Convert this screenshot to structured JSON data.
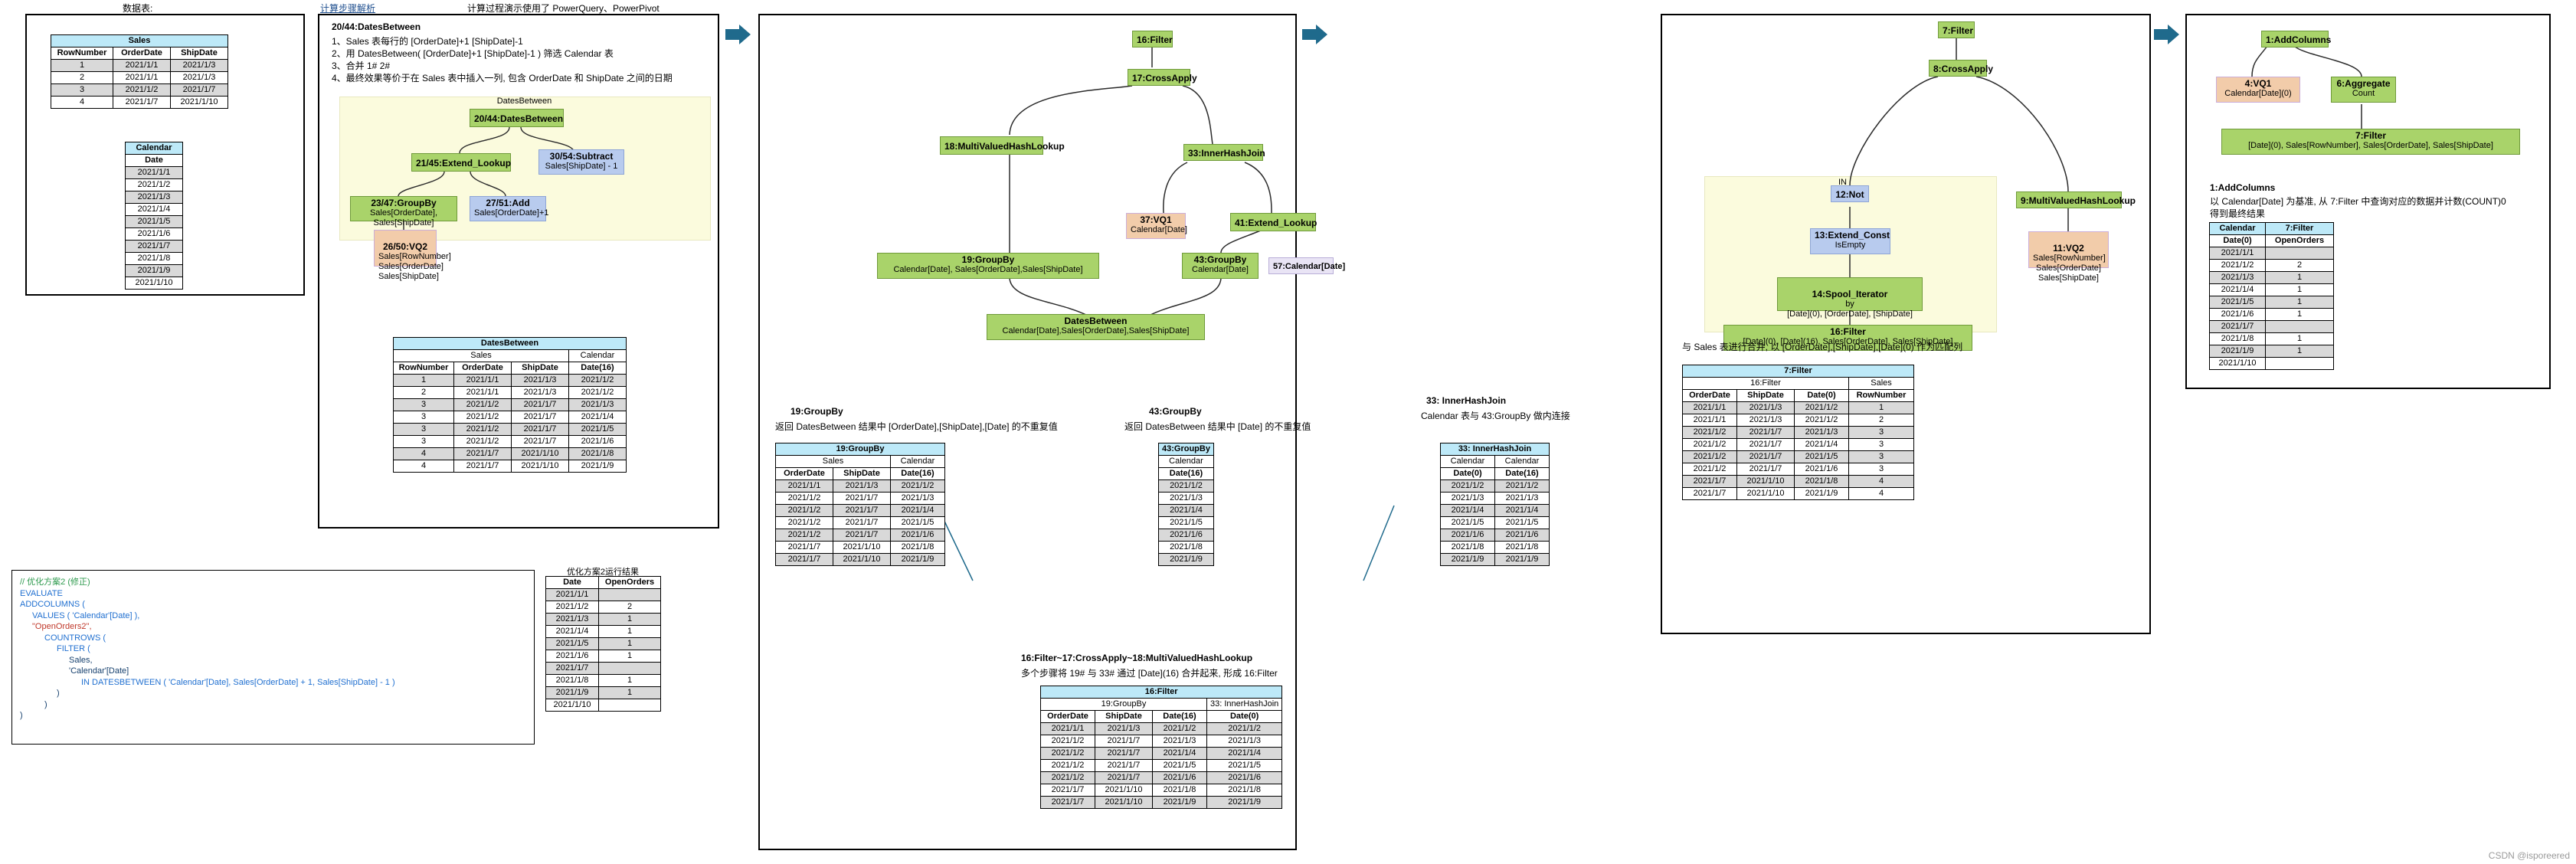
{
  "headers": {
    "data_tables_title": "数据表:",
    "steps_link": "计算步骤解析",
    "steps_note": "计算过程演示使用了 PowerQuery、PowerPivot"
  },
  "sales_table": {
    "name": "Sales",
    "columns": [
      "RowNumber",
      "OrderDate",
      "ShipDate"
    ],
    "rows": [
      [
        "1",
        "2021/1/1",
        "2021/1/3"
      ],
      [
        "2",
        "2021/1/1",
        "2021/1/3"
      ],
      [
        "3",
        "2021/1/2",
        "2021/1/7"
      ],
      [
        "4",
        "2021/1/7",
        "2021/1/10"
      ]
    ]
  },
  "calendar_table": {
    "name": "Calendar",
    "columns": [
      "Date"
    ],
    "rows": [
      "2021/1/1",
      "2021/1/2",
      "2021/1/3",
      "2021/1/4",
      "2021/1/5",
      "2021/1/6",
      "2021/1/7",
      "2021/1/8",
      "2021/1/9",
      "2021/1/10"
    ]
  },
  "dax_code": {
    "lines": [
      {
        "text": "// 优化方案2 (修正)",
        "cls": "c-cm",
        "indent": 0
      },
      {
        "text": "EVALUATE",
        "cls": "c-kw",
        "indent": 0
      },
      {
        "text": "ADDCOLUMNS (",
        "cls": "c-kw",
        "indent": 0
      },
      {
        "text": "VALUES ( 'Calendar'[Date] ),",
        "cls": "c-kw",
        "indent": 1
      },
      {
        "text": "\"OpenOrders2\",",
        "cls": "c-str",
        "indent": 1
      },
      {
        "text": "COUNTROWS (",
        "cls": "c-kw",
        "indent": 2
      },
      {
        "text": "FILTER (",
        "cls": "c-kw",
        "indent": 3
      },
      {
        "text": "Sales,",
        "cls": "c-pl",
        "indent": 4
      },
      {
        "text": "'Calendar'[Date]",
        "cls": "c-pl",
        "indent": 4
      },
      {
        "text": "IN DATESBETWEEN ( 'Calendar'[Date], Sales[OrderDate] + 1, Sales[ShipDate] - 1 )",
        "cls": "c-kw",
        "indent": 5
      },
      {
        "text": ")",
        "cls": "c-pl",
        "indent": 3
      },
      {
        "text": ")",
        "cls": "c-pl",
        "indent": 2
      },
      {
        "text": ")",
        "cls": "c-pl",
        "indent": 0
      }
    ]
  },
  "result_table": {
    "title": "优化方案2运行结果",
    "columns": [
      "Date",
      "OpenOrders"
    ],
    "rows": [
      [
        "2021/1/1",
        ""
      ],
      [
        "2021/1/2",
        "2"
      ],
      [
        "2021/1/3",
        "1"
      ],
      [
        "2021/1/4",
        "1"
      ],
      [
        "2021/1/5",
        "1"
      ],
      [
        "2021/1/6",
        "1"
      ],
      [
        "2021/1/7",
        ""
      ],
      [
        "2021/1/8",
        "1"
      ],
      [
        "2021/1/9",
        "1"
      ],
      [
        "2021/1/10",
        ""
      ]
    ]
  },
  "panel2": {
    "heading": "20/44:DatesBetween",
    "steps": [
      "1、Sales 表每行的 [OrderDate]+1 [ShipDate]-1",
      "2、用 DatesBetween( [OrderDate]+1 [ShipDate]-1 ) 筛选 Calendar 表",
      "3、合并 1# 2#",
      "4、最终效果等价于在 Sales 表中插入一列, 包含 OrderDate 和 ShipDate 之间的日期"
    ],
    "group_label": "DatesBetween",
    "nodes": {
      "n2044": {
        "title": "20/44:DatesBetween",
        "sub": ""
      },
      "n2145": {
        "title": "21/45:Extend_Lookup",
        "sub": ""
      },
      "n3054": {
        "title": "30/54:Subtract",
        "sub": "Sales[ShipDate] - 1"
      },
      "n2347": {
        "title": "23/47:GroupBy",
        "sub": "Sales[OrderDate], Sales[ShipDate]"
      },
      "n2751": {
        "title": "27/51:Add",
        "sub": "Sales[OrderDate]+1"
      },
      "n2650": {
        "title": "26/50:VQ2",
        "sub": "Sales[RowNumber]\nSales[OrderDate]\nSales[ShipDate]"
      }
    },
    "table": {
      "title": "DatesBetween",
      "groups": [
        {
          "label": "Sales",
          "span": 3
        },
        {
          "label": "Calendar",
          "span": 1
        }
      ],
      "columns": [
        "RowNumber",
        "OrderDate",
        "ShipDate",
        "Date(16)"
      ],
      "rows": [
        [
          "1",
          "2021/1/1",
          "2021/1/3",
          "2021/1/2"
        ],
        [
          "2",
          "2021/1/1",
          "2021/1/3",
          "2021/1/2"
        ],
        [
          "3",
          "2021/1/2",
          "2021/1/7",
          "2021/1/3"
        ],
        [
          "3",
          "2021/1/2",
          "2021/1/7",
          "2021/1/4"
        ],
        [
          "3",
          "2021/1/2",
          "2021/1/7",
          "2021/1/5"
        ],
        [
          "3",
          "2021/1/2",
          "2021/1/7",
          "2021/1/6"
        ],
        [
          "4",
          "2021/1/7",
          "2021/1/10",
          "2021/1/8"
        ],
        [
          "4",
          "2021/1/7",
          "2021/1/10",
          "2021/1/9"
        ]
      ]
    }
  },
  "panel3": {
    "nodes": {
      "n16": {
        "title": "16:Filter",
        "sub": ""
      },
      "n17": {
        "title": "17:CrossApply",
        "sub": ""
      },
      "n33": {
        "title": "33:InnerHashJoin",
        "sub": ""
      },
      "n18": {
        "title": "18:MultiValuedHashLookup",
        "sub": ""
      },
      "n37": {
        "title": "37:VQ1",
        "sub": "Calendar[Date]"
      },
      "n41": {
        "title": "41:Extend_Lookup",
        "sub": ""
      },
      "n19": {
        "title": "19:GroupBy",
        "sub": "Calendar[Date], Sales[OrderDate],Sales[ShipDate]"
      },
      "n43": {
        "title": "43:GroupBy",
        "sub": "Calendar[Date]"
      },
      "n57": {
        "title": "57:Calendar[Date]",
        "sub": ""
      },
      "ndb": {
        "title": "DatesBetween",
        "sub": "Calendar[Date],Sales[OrderDate],Sales[ShipDate]"
      }
    },
    "cap19": {
      "title": "19:GroupBy",
      "desc": "返回 DatesBetween 结果中 [OrderDate],[ShipDate],[Date] 的不重复值"
    },
    "cap43": {
      "title": "43:GroupBy",
      "desc": "返回 DatesBetween 结果中 [Date] 的不重复值"
    },
    "cap33": {
      "title": "33: InnerHashJoin",
      "desc": "Calendar 表与 43:GroupBy 做内连接"
    },
    "cap16": {
      "title": "16:Filter~17:CrossApply~18:MultiValuedHashLookup",
      "desc": "多个步骤将 19# 与 33# 通过 [Date](16) 合并起来, 形成 16:Filter"
    },
    "t19": {
      "title": "19:GroupBy",
      "groups": [
        {
          "label": "Sales",
          "span": 2
        },
        {
          "label": "Calendar",
          "span": 1
        }
      ],
      "columns": [
        "OrderDate",
        "ShipDate",
        "Date(16)"
      ],
      "rows": [
        [
          "2021/1/1",
          "2021/1/3",
          "2021/1/2"
        ],
        [
          "2021/1/2",
          "2021/1/7",
          "2021/1/3"
        ],
        [
          "2021/1/2",
          "2021/1/7",
          "2021/1/4"
        ],
        [
          "2021/1/2",
          "2021/1/7",
          "2021/1/5"
        ],
        [
          "2021/1/2",
          "2021/1/7",
          "2021/1/6"
        ],
        [
          "2021/1/7",
          "2021/1/10",
          "2021/1/8"
        ],
        [
          "2021/1/7",
          "2021/1/10",
          "2021/1/9"
        ]
      ]
    },
    "t43": {
      "title": "43:GroupBy",
      "groups": [
        {
          "label": "Calendar",
          "span": 1
        }
      ],
      "columns": [
        "Date(16)"
      ],
      "rows": [
        [
          "2021/1/2"
        ],
        [
          "2021/1/3"
        ],
        [
          "2021/1/4"
        ],
        [
          "2021/1/5"
        ],
        [
          "2021/1/6"
        ],
        [
          "2021/1/8"
        ],
        [
          "2021/1/9"
        ]
      ]
    },
    "t33": {
      "title": "33: InnerHashJoin",
      "groups": [
        {
          "label": "Calendar",
          "span": 1
        },
        {
          "label": "Calendar",
          "span": 1
        }
      ],
      "columns": [
        "Date(0)",
        "Date(16)"
      ],
      "rows": [
        [
          "2021/1/2",
          "2021/1/2"
        ],
        [
          "2021/1/3",
          "2021/1/3"
        ],
        [
          "2021/1/4",
          "2021/1/4"
        ],
        [
          "2021/1/5",
          "2021/1/5"
        ],
        [
          "2021/1/6",
          "2021/1/6"
        ],
        [
          "2021/1/8",
          "2021/1/8"
        ],
        [
          "2021/1/9",
          "2021/1/9"
        ]
      ]
    },
    "t16": {
      "title": "16:Filter",
      "groups": [
        {
          "label": "19:GroupBy",
          "span": 3
        },
        {
          "label": "33: InnerHashJoin",
          "span": 1
        }
      ],
      "columns": [
        "OrderDate",
        "ShipDate",
        "Date(16)",
        "Date(0)"
      ],
      "rows": [
        [
          "2021/1/1",
          "2021/1/3",
          "2021/1/2",
          "2021/1/2"
        ],
        [
          "2021/1/2",
          "2021/1/7",
          "2021/1/3",
          "2021/1/3"
        ],
        [
          "2021/1/2",
          "2021/1/7",
          "2021/1/4",
          "2021/1/4"
        ],
        [
          "2021/1/2",
          "2021/1/7",
          "2021/1/5",
          "2021/1/5"
        ],
        [
          "2021/1/2",
          "2021/1/7",
          "2021/1/6",
          "2021/1/6"
        ],
        [
          "2021/1/7",
          "2021/1/10",
          "2021/1/8",
          "2021/1/8"
        ],
        [
          "2021/1/7",
          "2021/1/10",
          "2021/1/9",
          "2021/1/9"
        ]
      ]
    }
  },
  "panel4": {
    "in_label": "IN",
    "nodes": {
      "n7": {
        "title": "7:Filter",
        "sub": ""
      },
      "n8": {
        "title": "8:CrossApply",
        "sub": ""
      },
      "n12": {
        "title": "12:Not",
        "sub": ""
      },
      "n9": {
        "title": "9:MultiValuedHashLookup",
        "sub": ""
      },
      "n13": {
        "title": "13:Extend_Const",
        "sub": "IsEmpty"
      },
      "n11": {
        "title": "11:VQ2",
        "sub": "Sales[RowNumber]\nSales[OrderDate]\nSales[ShipDate]"
      },
      "n14": {
        "title": "14:Spool_Iterator",
        "sub": "by\n[Date](0), [OrderDate], [ShipDate]"
      },
      "n16b": {
        "title": "16:Filter",
        "sub": "[Date](0), [Date](16), Sales[OrderDate], Sales[ShipDate]"
      }
    },
    "cap7": {
      "desc": "与 Sales 表进行合并, 以 [OrderDate],[ShipDate],[Date](0) 作为匹配列",
      "title": "7:Filter"
    },
    "t7": {
      "title": "7:Filter",
      "groups": [
        {
          "label": "16:Filter",
          "span": 3
        },
        {
          "label": "Sales",
          "span": 1
        }
      ],
      "columns": [
        "OrderDate",
        "ShipDate",
        "Date(0)",
        "RowNumber"
      ],
      "rows": [
        [
          "2021/1/1",
          "2021/1/3",
          "2021/1/2",
          "1"
        ],
        [
          "2021/1/1",
          "2021/1/3",
          "2021/1/2",
          "2"
        ],
        [
          "2021/1/2",
          "2021/1/7",
          "2021/1/3",
          "3"
        ],
        [
          "2021/1/2",
          "2021/1/7",
          "2021/1/4",
          "3"
        ],
        [
          "2021/1/2",
          "2021/1/7",
          "2021/1/5",
          "3"
        ],
        [
          "2021/1/2",
          "2021/1/7",
          "2021/1/6",
          "3"
        ],
        [
          "2021/1/7",
          "2021/1/10",
          "2021/1/8",
          "4"
        ],
        [
          "2021/1/7",
          "2021/1/10",
          "2021/1/9",
          "4"
        ]
      ]
    }
  },
  "panel5": {
    "nodes": {
      "n1": {
        "title": "1:AddColumns",
        "sub": ""
      },
      "n4": {
        "title": "4:VQ1",
        "sub": "Calendar[Date](0)"
      },
      "n6": {
        "title": "6:Aggregate",
        "sub": "Count"
      },
      "n7b": {
        "title": "7:Filter",
        "sub": "[Date](0), Sales[RowNumber], Sales[OrderDate], Sales[ShipDate]"
      }
    },
    "cap1": {
      "title": "1:AddColumns",
      "desc1": "以 Calendar[Date] 为基准, 从 7:Filter 中查询对应的数据并计数(COUNT)0",
      "desc2": "得到最终结果"
    },
    "t1": {
      "groups": [
        {
          "label": "Calendar",
          "span": 1
        },
        {
          "label": "7:Filter",
          "span": 1
        }
      ],
      "columns": [
        "Date(0)",
        "OpenOrders"
      ],
      "rows": [
        [
          "2021/1/1",
          ""
        ],
        [
          "2021/1/2",
          "2"
        ],
        [
          "2021/1/3",
          "1"
        ],
        [
          "2021/1/4",
          "1"
        ],
        [
          "2021/1/5",
          "1"
        ],
        [
          "2021/1/6",
          "1"
        ],
        [
          "2021/1/7",
          ""
        ],
        [
          "2021/1/8",
          "1"
        ],
        [
          "2021/1/9",
          "1"
        ],
        [
          "2021/1/10",
          ""
        ]
      ]
    }
  },
  "watermark": "CSDN @isporeered"
}
